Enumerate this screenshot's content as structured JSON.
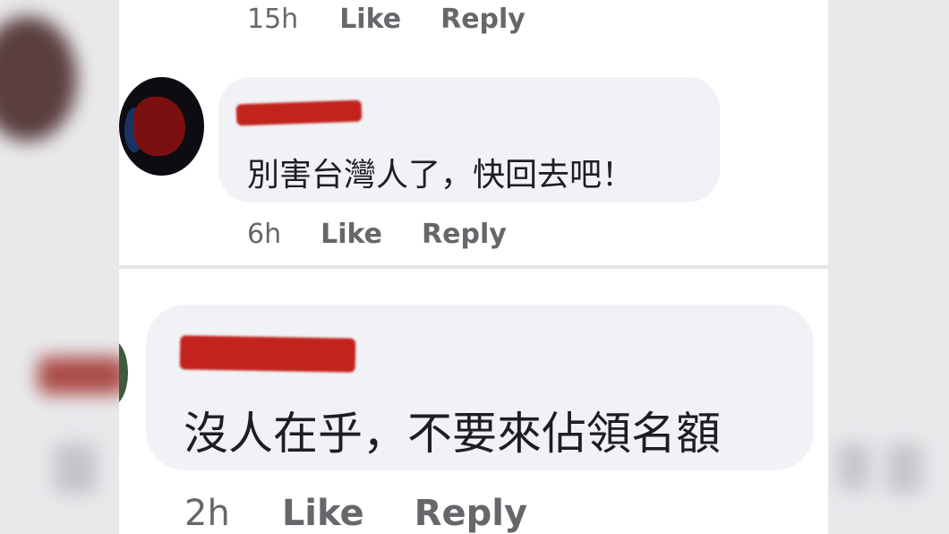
{
  "comments": [
    {
      "text": "",
      "time": "15h",
      "like_label": "Like",
      "reply_label": "Reply"
    },
    {
      "author": "",
      "text": "別害台灣人了，快回去吧！",
      "time": "6h",
      "like_label": "Like",
      "reply_label": "Reply"
    },
    {
      "author": "",
      "text": "沒人在乎，不要來佔領名額",
      "time": "2h",
      "like_label": "Like",
      "reply_label": "Reply"
    }
  ],
  "colors": {
    "bubble": "#f0f2f5",
    "action_text": "#65676b",
    "comment_text": "#1c1e21",
    "redaction": "#c2231d"
  }
}
